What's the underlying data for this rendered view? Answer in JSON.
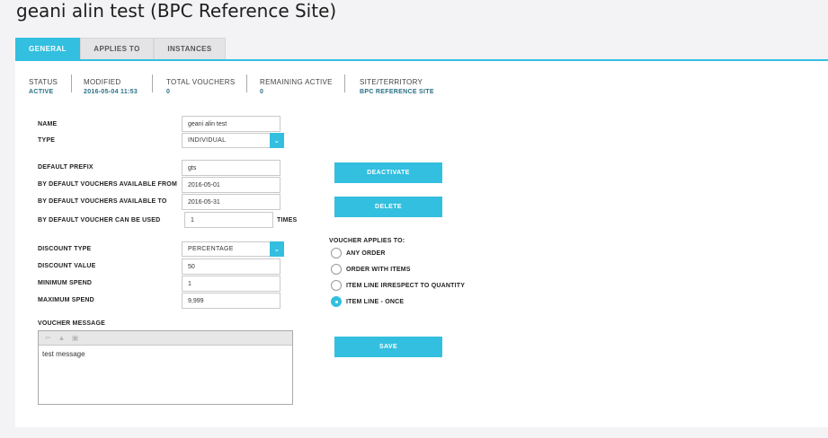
{
  "page": {
    "title": "geani alin test (BPC Reference Site)"
  },
  "tabs": [
    {
      "label": "GENERAL"
    },
    {
      "label": "APPLIES TO"
    },
    {
      "label": "INSTANCES"
    }
  ],
  "stats": {
    "status": {
      "label": "STATUS",
      "value": "ACTIVE"
    },
    "modified": {
      "label": "MODIFIED",
      "value": "2016-05-04 11:53"
    },
    "total_vouchers": {
      "label": "TOTAL VOUCHERS",
      "value": "0"
    },
    "remaining_active": {
      "label": "REMAINING ACTIVE",
      "value": "0"
    },
    "site": {
      "label": "SITE/TERRITORY",
      "value": "BPC REFERENCE SITE"
    }
  },
  "form": {
    "name": {
      "label": "NAME",
      "value": "geani alin test"
    },
    "type": {
      "label": "TYPE",
      "value": "INDIVIDUAL"
    },
    "prefix": {
      "label": "DEFAULT PREFIX",
      "value": "gts"
    },
    "available_from": {
      "label": "BY DEFAULT VOUCHERS AVAILABLE FROM",
      "value": "2016-05-01"
    },
    "available_to": {
      "label": "BY DEFAULT VOUCHERS AVAILABLE TO",
      "value": "2016-05-31"
    },
    "can_be_used": {
      "label": "BY DEFAULT VOUCHER CAN BE USED",
      "value": "1",
      "suffix": "TIMES"
    },
    "discount_type": {
      "label": "DISCOUNT TYPE",
      "value": "PERCENTAGE"
    },
    "discount_value": {
      "label": "DISCOUNT VALUE",
      "value": "50"
    },
    "minimum_spend": {
      "label": "MINIMUM SPEND",
      "value": "1"
    },
    "maximum_spend": {
      "label": "MAXIMUM SPEND",
      "value": "9,999"
    },
    "message": {
      "label": "VOUCHER MESSAGE",
      "value": "test message"
    }
  },
  "buttons": {
    "deactivate": "DEACTIVATE",
    "delete": "DELETE",
    "save": "SAVE"
  },
  "applies_to": {
    "label": "VOUCHER APPLIES TO:",
    "options": [
      {
        "label": "ANY ORDER",
        "checked": false
      },
      {
        "label": "ORDER WITH ITEMS",
        "checked": false
      },
      {
        "label": "ITEM LINE IRRESPECT TO QUANTITY",
        "checked": false
      },
      {
        "label": "ITEM LINE - ONCE",
        "checked": true
      }
    ]
  },
  "colors": {
    "accent": "#33bfdf",
    "stat_value": "#2a6f86"
  }
}
